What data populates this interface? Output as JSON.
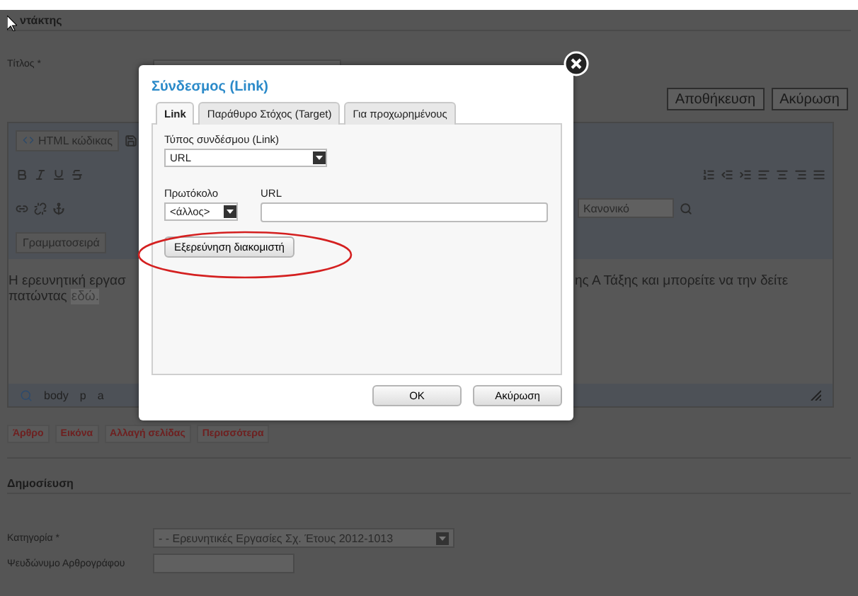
{
  "page": {
    "author_heading": "ντάκτης",
    "title_label": "Τίτλος *",
    "buttons": [
      "Αποθήκευση",
      "Ακύρωση"
    ],
    "editor": {
      "html_button": "HTML κώδικας",
      "format_select": "Κανονικό",
      "font_label": "Γραμματοσειρά",
      "text_left": "Η ερευνητική εργασ",
      "text_right": "ης Α Τάξης και μπορείτε να την δείτε",
      "text_line2": "πατώντας",
      "link_text": "εδώ.",
      "path": [
        "body",
        "p",
        "a"
      ]
    },
    "insert_buttons": [
      "Άρθρο",
      "Εικόνα",
      "Αλλαγή σελίδας",
      "Περισσότερα"
    ],
    "publish_heading": "Δημοσίευση",
    "fields": [
      {
        "label": "Κατηγορία *",
        "kind": "select",
        "value": "- - Ερευνητικές Εργασίες Σχ. Έτους 2012-1013"
      },
      {
        "label": "Ψευδώνυμο Αρθρογράφου",
        "kind": "input"
      }
    ]
  },
  "dialog": {
    "title": "Σύνδεσμος (Link)",
    "tabs": [
      {
        "label": "Link",
        "selected": true
      },
      {
        "label": "Παράθυρο Στόχος (Target)",
        "selected": false
      },
      {
        "label": "Για προχωρημένους",
        "selected": false
      }
    ],
    "link_type_label": "Τύπος συνδέσμου (Link)",
    "link_type": "URL",
    "protocol_label": "Πρωτόκολο",
    "protocol": "<άλλος>",
    "url_label": "URL",
    "browse_button": "Εξερεύνηση διακομιστή",
    "buttons": [
      "OK",
      "Ακύρωση"
    ]
  }
}
